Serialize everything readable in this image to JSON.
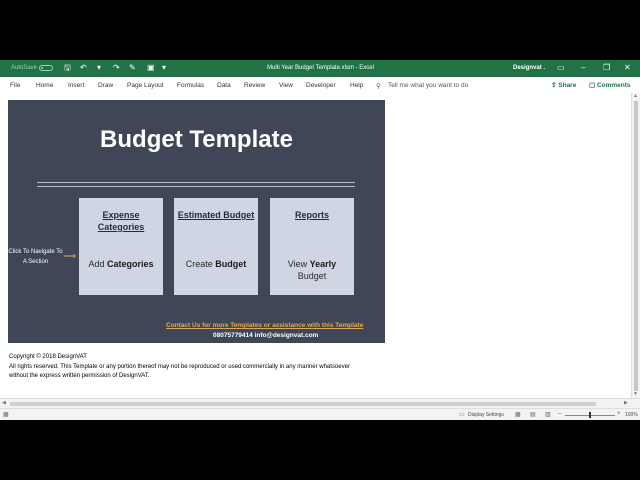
{
  "window": {
    "autosave_label": "AutoSave",
    "doc_title": "Multi Year Budget Template.xlsm  -  Excel",
    "user_name": "Designvat ."
  },
  "ribbon": {
    "tabs": [
      "File",
      "Home",
      "Insert",
      "Draw",
      "Page Layout",
      "Formulas",
      "Data",
      "Review",
      "View",
      "Developer",
      "Help"
    ],
    "tell_me": "Tell me what you want to do",
    "share": "Share",
    "comments": "Comments"
  },
  "dashboard": {
    "title": "Budget Template",
    "nav_label": "Click To Navigate To A Section",
    "cards": [
      {
        "title": "Expense Categories",
        "body_prefix": "Add ",
        "body_bold": "Categories",
        "body_suffix": ""
      },
      {
        "title": "Estimated Budget",
        "body_prefix": "Create ",
        "body_bold": "Budget",
        "body_suffix": ""
      },
      {
        "title": "Reports",
        "body_prefix": "View ",
        "body_bold": "Yearly",
        "body_suffix": "Budget"
      }
    ],
    "contact_link": "Contact Us for more Templates or assistance with this Template",
    "contact_info": "08075779414  info@designvat.com"
  },
  "footer": {
    "copyright": "Copyright © 2018 DesignVAT",
    "rights_line1": "All rights reserved. This Template or any portion thereof may not be reproduced or used commercially in any manner whatsoever",
    "rights_line2": "without the express written permission of DesignVAT."
  },
  "status": {
    "display_settings": "Display Settings",
    "zoom": "100%"
  },
  "colors": {
    "excel_green": "#217346",
    "panel": "#3f4757",
    "card": "#cfd5e2",
    "accent_link": "#e0a855"
  }
}
